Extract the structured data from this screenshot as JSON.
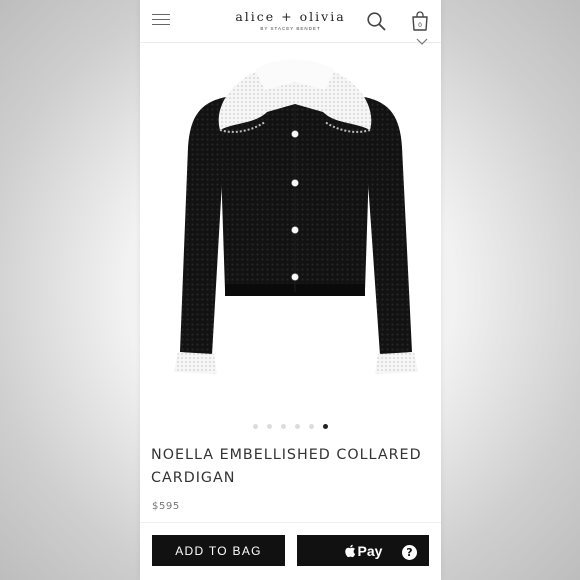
{
  "header": {
    "brand": "alice + olivia",
    "brand_sub": "BY STACEY BENDET",
    "bag_count": "0"
  },
  "icons": {
    "menu": "hamburger-icon",
    "search": "search-icon",
    "bag": "shopping-bag-icon",
    "chevron": "chevron-down-icon",
    "help": "help-icon"
  },
  "gallery": {
    "image": "cardigan-product-photo",
    "total_slides": 6,
    "active_slide": 6
  },
  "product": {
    "title_line1": "NOELLA EMBELLISHED COLLARED",
    "title_line2": "CARDIGAN",
    "price": "$595"
  },
  "actions": {
    "add_to_bag": "ADD TO BAG",
    "apple_pay": "Pay",
    "help": "?"
  },
  "colors": {
    "button_bg": "#111111",
    "text": "#333333",
    "price": "#777777",
    "dot_active": "#222222",
    "dot_inactive": "#dcdcdc"
  }
}
